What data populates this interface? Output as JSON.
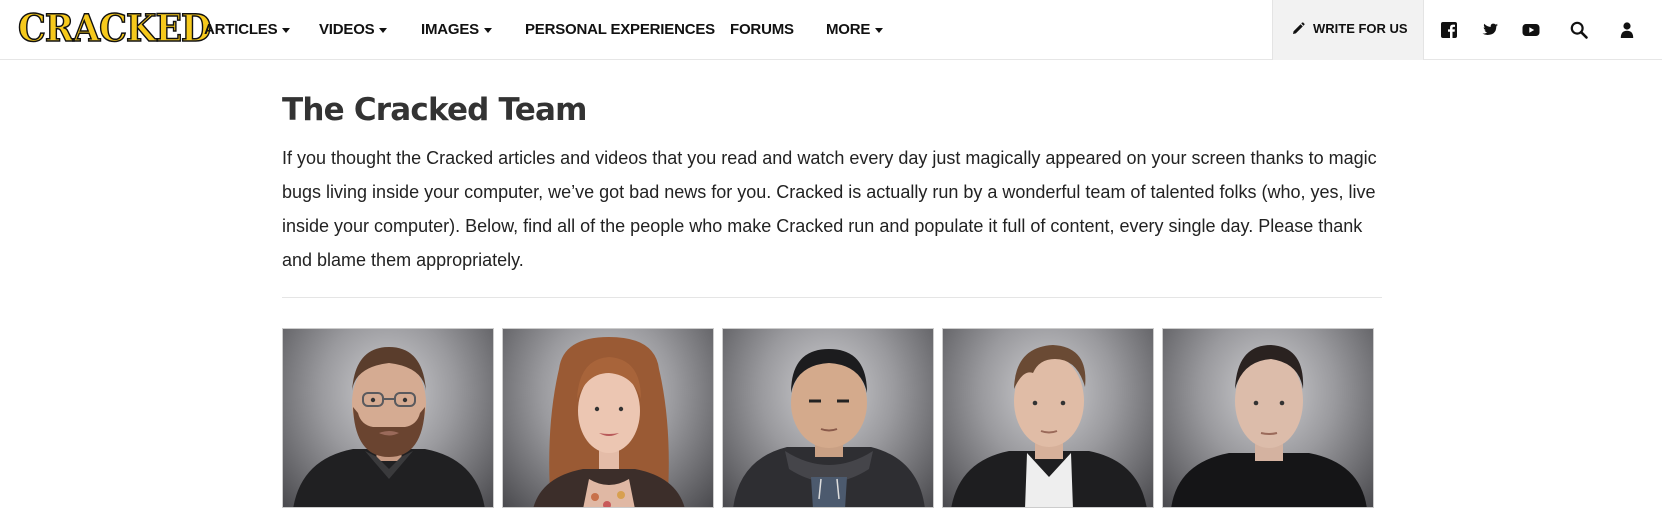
{
  "header": {
    "logo": "CRACKED",
    "menu": [
      {
        "label": "ARTICLES",
        "dropdown": true
      },
      {
        "label": "VIDEOS",
        "dropdown": true
      },
      {
        "label": "IMAGES",
        "dropdown": true
      },
      {
        "label": "PERSONAL EXPERIENCES",
        "dropdown": false
      },
      {
        "label": "FORUMS",
        "dropdown": false
      },
      {
        "label": "MORE",
        "dropdown": true
      }
    ],
    "write_for_us": "WRITE FOR US",
    "icons": [
      "facebook-icon",
      "twitter-icon",
      "youtube-icon",
      "search-icon",
      "user-icon"
    ]
  },
  "main": {
    "title": "The Cracked Team",
    "intro": "If you thought the Cracked articles and videos that you read and watch every day just magically appeared on your screen thanks to magic bugs living inside your computer, we’ve got bad news for you. Cracked is actually run by a wonderful team of talented folks (who, yes, live inside your computer). Below, find all of the people who make Cracked run and populate it full of content, every single day. Please thank and blame them appropriately.",
    "team_photos": [
      {
        "name": "team-member-photo-1"
      },
      {
        "name": "team-member-photo-2"
      },
      {
        "name": "team-member-photo-3"
      },
      {
        "name": "team-member-photo-4"
      },
      {
        "name": "team-member-photo-5"
      }
    ]
  },
  "colors": {
    "logo_fill": "#f6c91c",
    "nav_text": "#111111",
    "write_bg": "#f2f2f2",
    "title_text": "#333333"
  }
}
